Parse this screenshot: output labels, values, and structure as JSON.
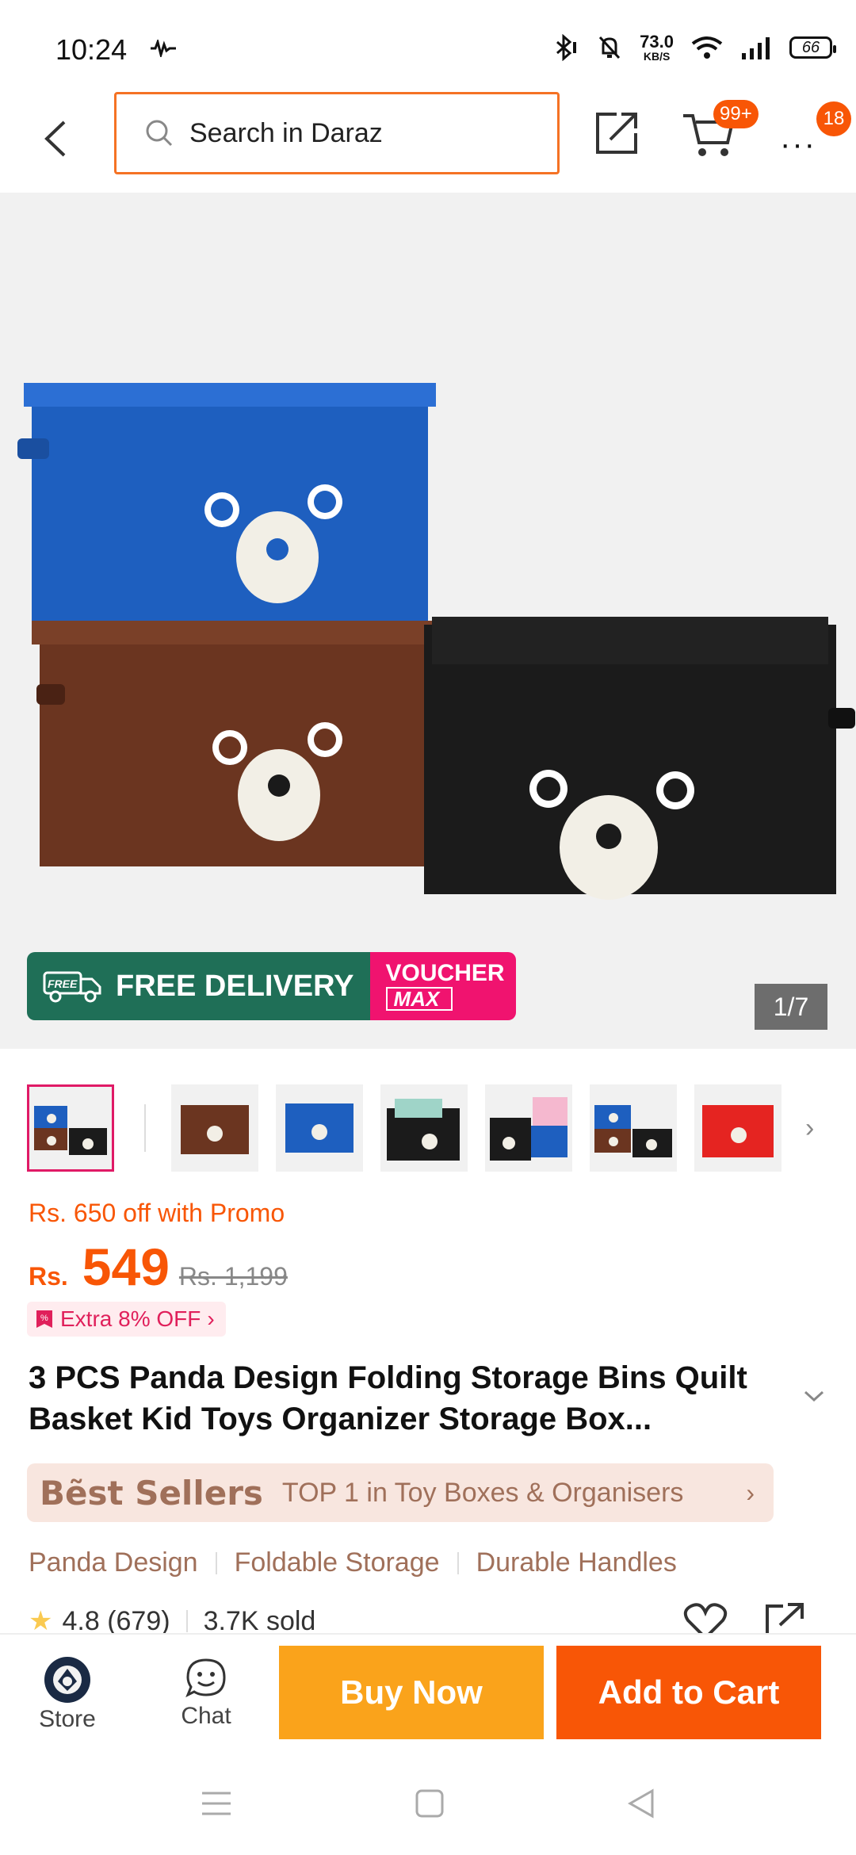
{
  "status_bar": {
    "time": "10:24",
    "net_speed_value": "73.0",
    "net_speed_unit": "KB/S",
    "battery": "66"
  },
  "search": {
    "placeholder": "Search in Daraz"
  },
  "header": {
    "cart_badge": "99+",
    "more_badge": "18"
  },
  "gallery": {
    "free_delivery_label": "FREE DELIVERY",
    "free_tag": "FREE",
    "voucher_label": "VOUCHER",
    "voucher_max": "MAX",
    "counter": "1/7"
  },
  "price": {
    "promo_text": "Rs. 650 off with Promo",
    "currency": "Rs.",
    "current": "549",
    "original": "Rs. 1,199",
    "extra_off": "Extra 8% OFF"
  },
  "product": {
    "title": "3 PCS Panda Design Folding Storage Bins Quilt Basket Kid Toys Organizer Storage Box..."
  },
  "best_seller": {
    "label": "Bẽst Sellers",
    "text": "TOP 1 in Toy Boxes & Organisers"
  },
  "tags": [
    "Panda Design",
    "Foldable Storage",
    "Durable Handles"
  ],
  "rating": {
    "score": "4.8 (679)",
    "sold": "3.7K sold"
  },
  "bottom_bar": {
    "store_label": "Store",
    "chat_label": "Chat",
    "buy_now_label": "Buy Now",
    "add_to_cart_label": "Add to Cart"
  },
  "colors": {
    "accent": "#f85606",
    "buy_now": "#faa31b",
    "free_delivery": "#1f6f57",
    "voucher": "#f0136f"
  }
}
